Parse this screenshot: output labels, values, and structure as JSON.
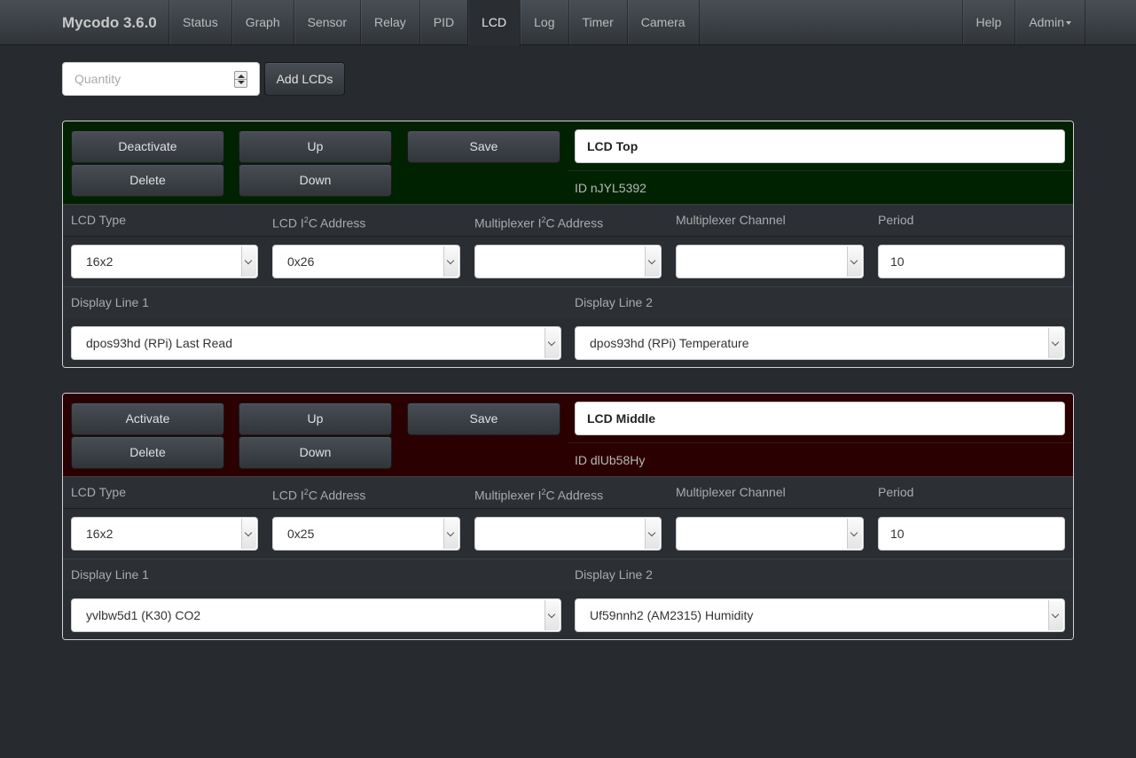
{
  "navbar": {
    "brand": "Mycodo 3.6.0",
    "items": [
      {
        "label": "Status"
      },
      {
        "label": "Graph"
      },
      {
        "label": "Sensor"
      },
      {
        "label": "Relay"
      },
      {
        "label": "PID"
      },
      {
        "label": "LCD",
        "active": true
      },
      {
        "label": "Log"
      },
      {
        "label": "Timer"
      },
      {
        "label": "Camera"
      }
    ],
    "right_items": [
      {
        "label": "Help"
      },
      {
        "label": "Admin"
      }
    ]
  },
  "add_form": {
    "quantity_placeholder": "Quantity",
    "add_button": "Add LCDs"
  },
  "labels": {
    "lcd_type": "LCD Type",
    "lcd_i2c_prefix": "LCD I",
    "mux_i2c_prefix": "Multiplexer I",
    "sup_2": "2",
    "c_address": "C Address",
    "mux_channel": "Multiplexer Channel",
    "period": "Period",
    "display_line_1": "Display Line 1",
    "display_line_2": "Display Line 2",
    "up": "Up",
    "down": "Down",
    "delete": "Delete",
    "save": "Save"
  },
  "lcds": [
    {
      "status_color": "#002200",
      "activate_label": "Deactivate",
      "name": "LCD Top",
      "id_text": "ID nJYL5392",
      "lcd_type": "16x2",
      "i2c_address": "0x26",
      "mux_address": "",
      "mux_channel": "",
      "period": "10",
      "line1": "dpos93hd (RPi) Last Read",
      "line2": "dpos93hd (RPi) Temperature"
    },
    {
      "status_color": "#2a0000",
      "activate_label": "Activate",
      "name": "LCD Middle",
      "id_text": "ID dlUb58Hy",
      "lcd_type": "16x2",
      "i2c_address": "0x25",
      "mux_address": "",
      "mux_channel": "",
      "period": "10",
      "line1": "yvlbw5d1 (K30) CO2",
      "line2": "Uf59nnh2 (AM2315) Humidity"
    }
  ]
}
